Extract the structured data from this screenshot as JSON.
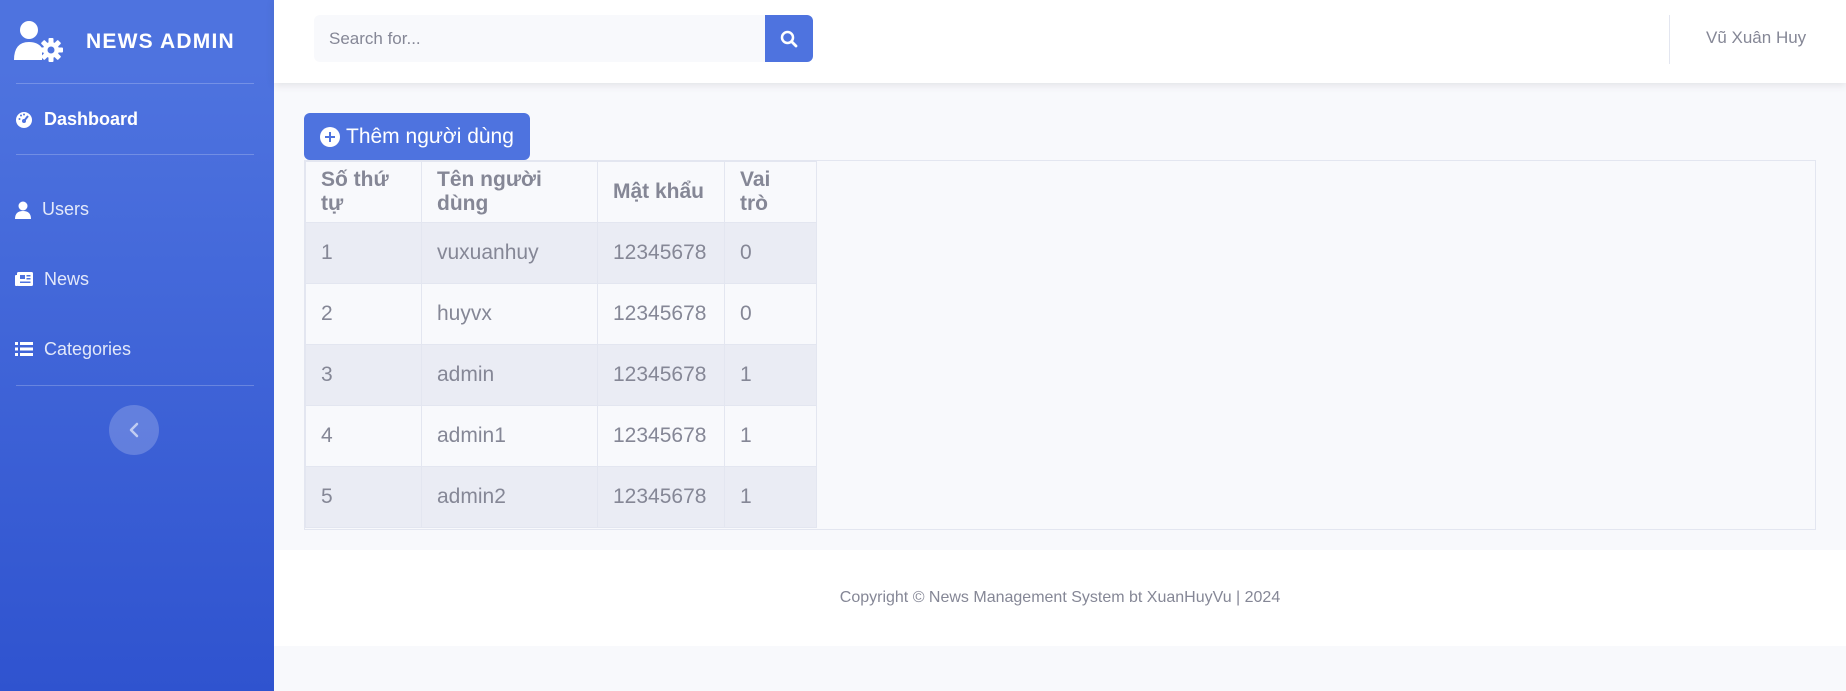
{
  "sidebar": {
    "brand": "NEWS ADMIN",
    "brand_icon": "user-gear-icon",
    "items": [
      {
        "label": "Dashboard",
        "icon": "tachometer-icon",
        "active": true
      },
      {
        "label": "Users",
        "icon": "user-icon"
      },
      {
        "label": "News",
        "icon": "newspaper-icon"
      },
      {
        "label": "Categories",
        "icon": "list-icon"
      }
    ],
    "toggle_icon": "chevron-left-icon"
  },
  "topbar": {
    "search_placeholder": "Search for...",
    "search_icon": "search-icon",
    "user_name": "Vũ Xuân Huy"
  },
  "main": {
    "add_button_label": "Thêm người dùng",
    "table": {
      "headers": [
        "Số thứ tự",
        "Tên người dùng",
        "Mật khẩu",
        "Vai trò"
      ],
      "rows": [
        [
          "1",
          "vuxuanhuy",
          "12345678",
          "0"
        ],
        [
          "2",
          "huyvx",
          "12345678",
          "0"
        ],
        [
          "3",
          "admin",
          "12345678",
          "1"
        ],
        [
          "4",
          "admin1",
          "12345678",
          "1"
        ],
        [
          "5",
          "admin2",
          "12345678",
          "1"
        ]
      ]
    }
  },
  "footer": {
    "text": "Copyright © News Management System bt XuanHuyVu | 2024"
  },
  "colors": {
    "primary": "#4e73df",
    "text_muted": "#858796",
    "background": "#f8f9fc"
  }
}
